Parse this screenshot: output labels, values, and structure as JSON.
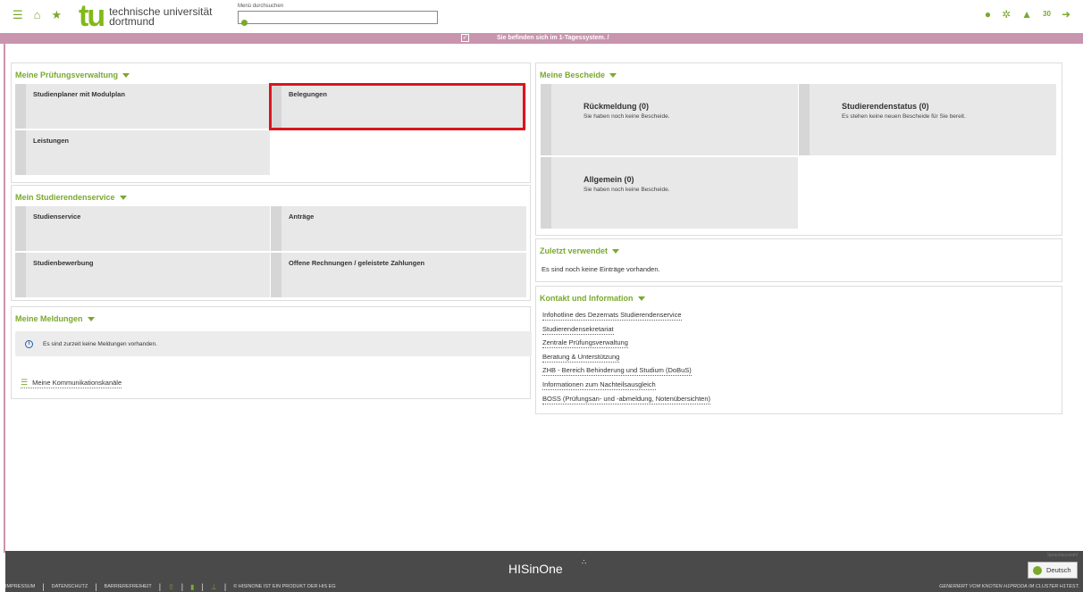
{
  "header": {
    "logo_tu": "tu",
    "logo_line1": "technische universität",
    "logo_line2": "dortmund",
    "search_label": "Menü durchsuchen",
    "search_value": "",
    "notification_count": "30",
    "accent": "#7aa92e"
  },
  "status_bar": {
    "text": "Sie befinden sich im 1-Tagessystem. /",
    "color": "#c994ad"
  },
  "pruefung": {
    "title": "Meine Prüfungsverwaltung",
    "tiles": [
      "Studienplaner mit Modulplan",
      "Belegungen",
      "Leistungen"
    ]
  },
  "service": {
    "title": "Mein Studierendenservice",
    "tiles": [
      "Studienservice",
      "Anträge",
      "Studienbewerbung",
      "Offene Rechnungen / geleistete Zahlungen"
    ]
  },
  "meldungen": {
    "title": "Meine Meldungen",
    "message": "Es sind zurzeit keine Meldungen vorhanden.",
    "channels": "Meine Kommunikationskanäle"
  },
  "bescheide": {
    "title": "Meine Bescheide",
    "tiles": [
      {
        "head": "Rückmeldung (0)",
        "sub": "Sie haben noch keine Bescheide."
      },
      {
        "head": "Studierendenstatus (0)",
        "sub": "Es stehen keine neuen Bescheide für Sie bereit."
      },
      {
        "head": "Allgemein (0)",
        "sub": "Sie haben noch keine Bescheide."
      }
    ]
  },
  "zuletzt": {
    "title": "Zuletzt verwendet",
    "text": "Es sind noch keine Einträge vorhanden."
  },
  "kontakt": {
    "title": "Kontakt und Information",
    "links": [
      "Infohotline des Dezernats Studierendenservice",
      "Studierendensekretariat",
      "Zentrale Prüfungsverwaltung",
      "Beratung & Unterstützung",
      "ZHB - Bereich Behinderung und Studium (DoBuS)",
      "Informationen zum Nachteilsausgleich",
      "BOSS (Prüfungsan- und -abmeldung, Notenübersichten)"
    ]
  },
  "footer": {
    "logo": "HISinOne",
    "links": [
      "IMPRESSUM",
      "DATENSCHUTZ",
      "BARRIEREFREIHEIT"
    ],
    "product": "© HISINONE IST EIN PRODUKT DER HIS EG",
    "node": "GENERIERT VOM KNOTEN H1PRODA IM CLUSTER H1TEST.",
    "language_label": "Sprachauswahl",
    "language": "Deutsch"
  }
}
